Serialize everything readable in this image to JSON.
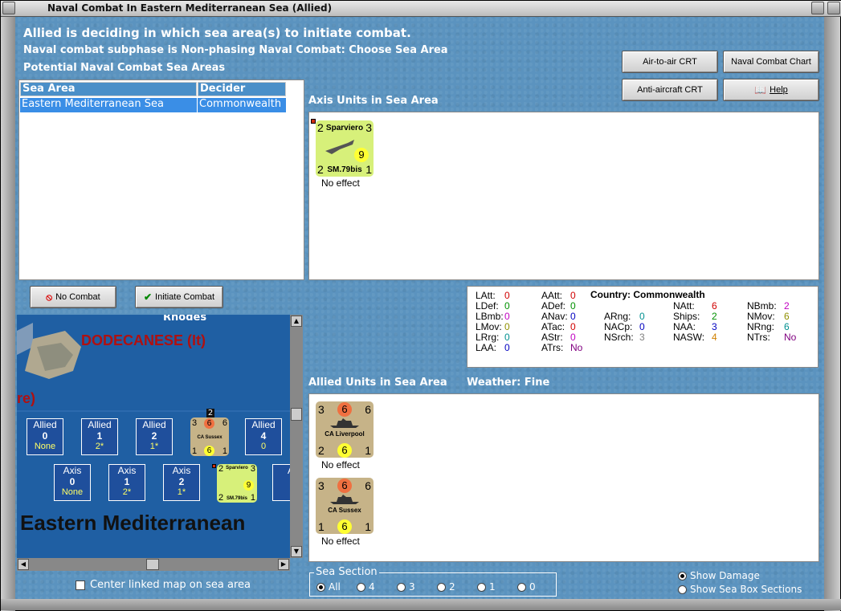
{
  "window": {
    "title": "Naval Combat In Eastern Mediterranean Sea (Allied)"
  },
  "header": {
    "line1": "Allied is deciding in which sea area(s) to initiate combat.",
    "line2": "Naval combat subphase is Non-phasing Naval Combat: Choose Sea Area",
    "line3": "Potential Naval Combat Sea Areas"
  },
  "buttons": {
    "air_to_air": "Air-to-air CRT",
    "naval_chart": "Naval Combat Chart",
    "anti_aircraft": "Anti-aircraft CRT",
    "help": "Help",
    "no_combat": "No Combat",
    "initiate": "Initiate Combat"
  },
  "table": {
    "headers": [
      "Sea Area",
      "Decider"
    ],
    "rows": [
      {
        "sea_area": "Eastern Mediterranean Sea",
        "decider": "Commonwealth"
      }
    ]
  },
  "axis_panel": {
    "label": "Axis Units in Sea Area",
    "unit": {
      "top_left": "2",
      "name": "Sparviero",
      "top_right": "3",
      "mid": "9",
      "bottom_left": "2",
      "type": "SM.79bis",
      "bottom_right": "1",
      "effect": "No effect"
    }
  },
  "stats": {
    "country": "Country: Commonwealth",
    "items": [
      {
        "k": "LAtt:",
        "v": "0",
        "c": "#d00000"
      },
      {
        "k": "LDef:",
        "v": "0",
        "c": "#009000"
      },
      {
        "k": "LBmb:",
        "v": "0",
        "c": "#c000c0"
      },
      {
        "k": "LMov:",
        "v": "0",
        "c": "#909000"
      },
      {
        "k": "LRrg:",
        "v": "0",
        "c": "#009090"
      },
      {
        "k": "LAA:",
        "v": "0",
        "c": "#0000c0"
      },
      {
        "k": "AAtt:",
        "v": "0",
        "c": "#d00000"
      },
      {
        "k": "ADef:",
        "v": "0",
        "c": "#009000"
      },
      {
        "k": "ANav:",
        "v": "0",
        "c": "#0000c0"
      },
      {
        "k": "ATac:",
        "v": "0",
        "c": "#d00000"
      },
      {
        "k": "AStr:",
        "v": "0",
        "c": "#c000c0"
      },
      {
        "k": "ATrs:",
        "v": "No",
        "c": "#800080"
      },
      {
        "k": "ARng:",
        "v": "0",
        "c": "#009090"
      },
      {
        "k": "NACp:",
        "v": "0",
        "c": "#0000c0"
      },
      {
        "k": "NSrch:",
        "v": "3",
        "c": "#808080"
      },
      {
        "k": "NAtt:",
        "v": "6",
        "c": "#d00000"
      },
      {
        "k": "Ships:",
        "v": "2",
        "c": "#009000"
      },
      {
        "k": "NAA:",
        "v": "3",
        "c": "#0000c0"
      },
      {
        "k": "NASW:",
        "v": "4",
        "c": "#d08000"
      },
      {
        "k": "NBmb:",
        "v": "2",
        "c": "#c000c0"
      },
      {
        "k": "NMov:",
        "v": "6",
        "c": "#909000"
      },
      {
        "k": "NRng:",
        "v": "6",
        "c": "#009090"
      },
      {
        "k": "NTrs:",
        "v": "No",
        "c": "#800080"
      }
    ]
  },
  "allied_panel": {
    "label": "Allied Units in Sea Area",
    "weather": "Weather:  Fine",
    "units": [
      {
        "tl": "3",
        "mid": "6",
        "tr": "6",
        "name": "CA Liverpool",
        "bl": "2",
        "circ": "6",
        "br": "1",
        "effect": "No effect"
      },
      {
        "tl": "3",
        "mid": "6",
        "tr": "6",
        "name": "CA Sussex",
        "bl": "1",
        "circ": "6",
        "br": "1",
        "effect": "No effect"
      }
    ]
  },
  "map": {
    "title": "DODECANESE (It)",
    "rhodes": "Rhodes",
    "partial": "re)",
    "sea": "Eastern Mediterranean",
    "allied_boxes": [
      {
        "l": "Allied",
        "v": "0",
        "s": "None"
      },
      {
        "l": "Allied",
        "v": "1",
        "s": "2*"
      },
      {
        "l": "Allied",
        "v": "2",
        "s": "1*"
      },
      {
        "l": "Allied",
        "v": "4",
        "s": "0"
      }
    ],
    "axis_boxes": [
      {
        "l": "Axis",
        "v": "0",
        "s": "None"
      },
      {
        "l": "Axis",
        "v": "1",
        "s": "2*"
      },
      {
        "l": "Axis",
        "v": "2",
        "s": "1*"
      },
      {
        "l": "A",
        "v": "",
        "s": ""
      }
    ],
    "stack_count": "2",
    "sussex": {
      "tl": "3",
      "mid": "6",
      "tr": "6",
      "name": "CA Sussex",
      "bl": "1",
      "circ": "6",
      "br": "1"
    },
    "sparviero": {
      "tl": "2",
      "name": "Sparviero",
      "tr": "3",
      "mid": "9",
      "bl": "2",
      "type": "SM.79bis",
      "br": "1"
    }
  },
  "options": {
    "center_map": "Center linked map on sea area",
    "sea_section_label": "Sea Section",
    "sections": [
      "All",
      "4",
      "3",
      "2",
      "1",
      "0"
    ],
    "show_damage": "Show Damage",
    "show_sections": "Show Sea Box Sections"
  }
}
